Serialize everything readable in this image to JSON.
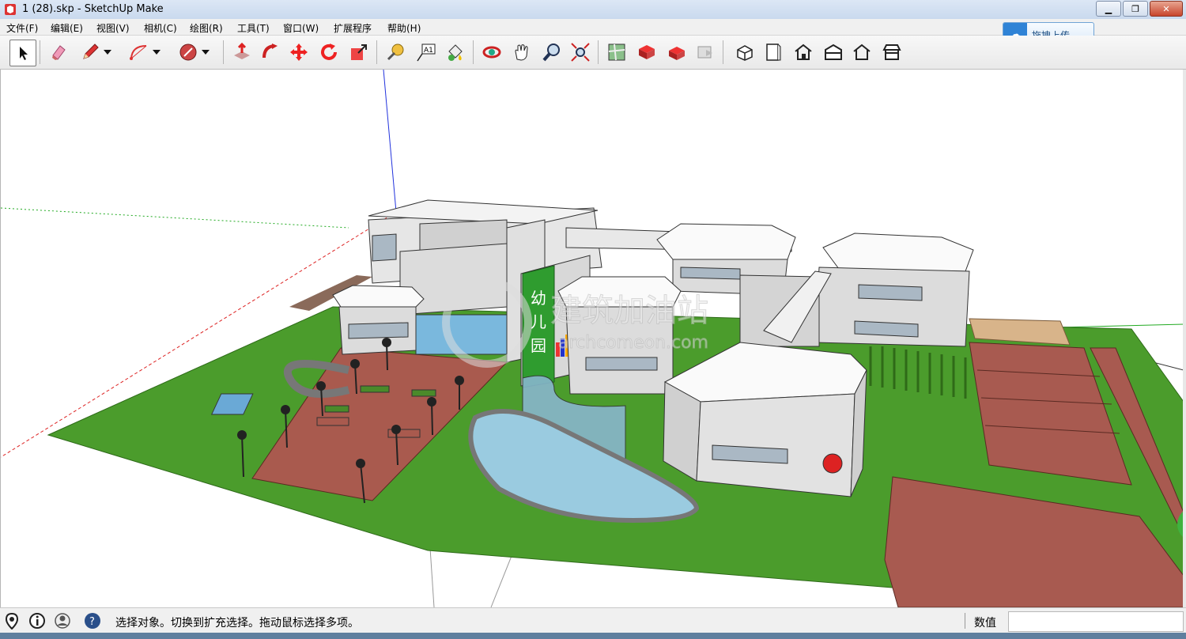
{
  "window": {
    "title": "1 (28).skp - SketchUp Make",
    "minimize": "▁",
    "restore": "❐",
    "close": "✕"
  },
  "menu": [
    {
      "id": "file",
      "label": "文件(F)"
    },
    {
      "id": "edit",
      "label": "编辑(E)"
    },
    {
      "id": "view",
      "label": "视图(V)"
    },
    {
      "id": "camera",
      "label": "相机(C)"
    },
    {
      "id": "draw",
      "label": "绘图(R)"
    },
    {
      "id": "tools",
      "label": "工具(T)"
    },
    {
      "id": "window",
      "label": "窗口(W)"
    },
    {
      "id": "extensions",
      "label": "扩展程序"
    },
    {
      "id": "help",
      "label": "帮助(H)"
    }
  ],
  "upload": {
    "label": "拖拽上传"
  },
  "toolbar": {
    "icons": [
      "select-icon",
      "eraser-icon",
      "pencil-icon",
      "arc-icon",
      "polygon-icon",
      "push-pull-icon",
      "follow-me-icon",
      "move-icon",
      "rotate-icon",
      "scale-icon",
      "tape-measure-icon",
      "text-icon",
      "paint-bucket-icon",
      "orbit-icon",
      "pan-icon",
      "zoom-icon",
      "zoom-extents-icon",
      "geo-location-icon",
      "warehouse-icon",
      "extension-warehouse-icon",
      "layout-icon",
      "iso-view-icon",
      "top-view-icon",
      "front-view-icon",
      "right-view-icon",
      "back-view-icon",
      "left-view-icon"
    ],
    "text_tool_label": "A1"
  },
  "model": {
    "signage": {
      "line1": "幼",
      "line2": "儿",
      "line3": "园"
    },
    "watermark": {
      "name": "建筑加油站",
      "url": "archcomeon.com"
    }
  },
  "status": {
    "message": "选择对象。切换到扩充选择。拖动鼠标选择多项。",
    "measurement_label": "数值",
    "measurement_value": ""
  },
  "colors": {
    "grass": "#4a9a2a",
    "plaza": "#a95a4e",
    "building": "#e4e4e4",
    "red_axis": "#d22",
    "green_axis": "#2a2",
    "blue_axis": "#22d"
  }
}
